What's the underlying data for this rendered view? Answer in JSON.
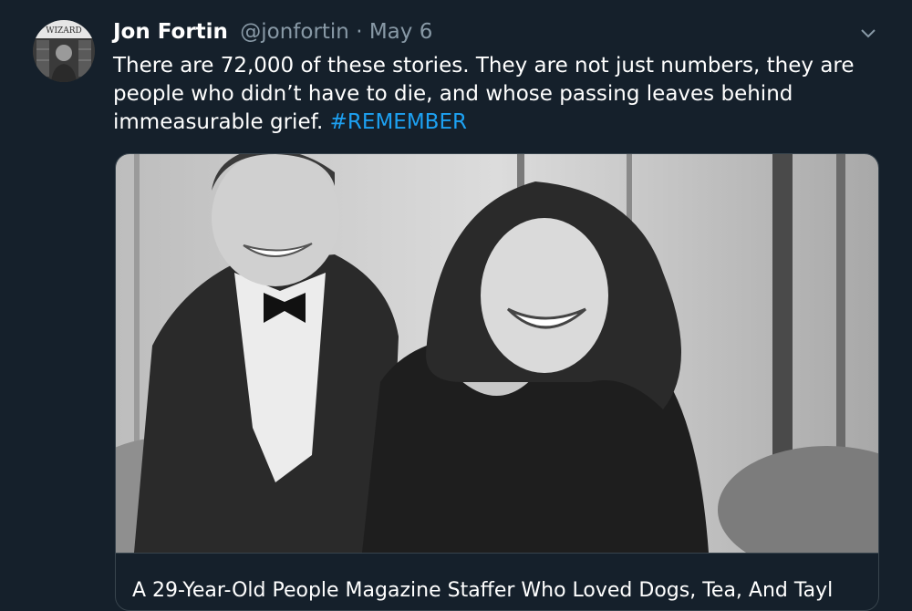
{
  "tweet": {
    "author_name": "Jon Fortin",
    "author_handle": "@jonfortin",
    "separator": "·",
    "date": "May 6",
    "text": "There are 72,000 of these stories. They are not just numbers, they are people who didn’t have to die, and whose passing leaves behind immeasurable grief.",
    "hashtag": "#REMEMBER",
    "avatar_sign_text": "WIZARD",
    "menu_icon": "chevron-down-icon",
    "card": {
      "title": "A 29-Year-Old People Magazine Staffer Who Loved Dogs, Tea, And Tayl",
      "image_icon": "photo-icon"
    }
  },
  "colors": {
    "background": "#15202b",
    "text": "#ffffff",
    "secondary_text": "#8899a6",
    "link": "#1da1f2",
    "border": "#38444d"
  }
}
